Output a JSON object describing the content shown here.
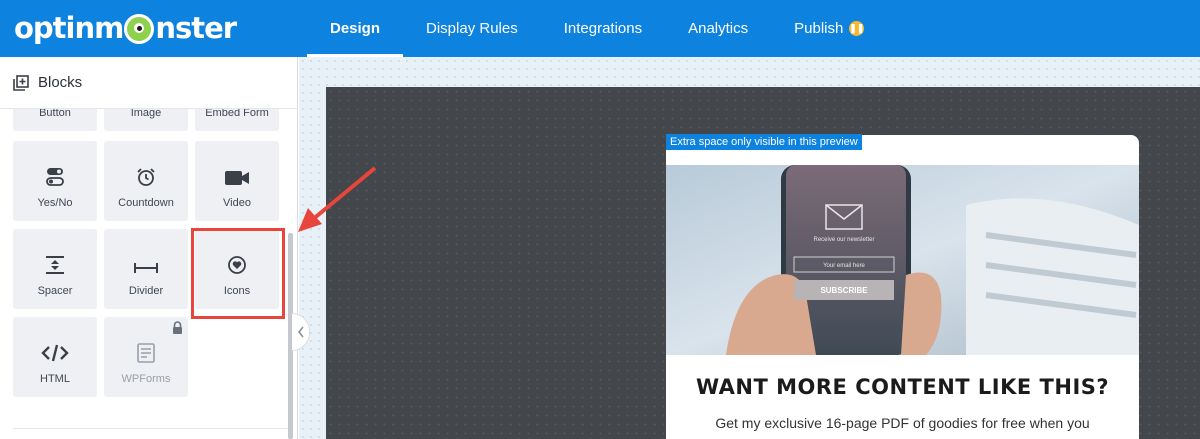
{
  "brand": {
    "logo_text_left": "optinm",
    "logo_text_right": "nster"
  },
  "nav": {
    "items": [
      {
        "label": "Design",
        "active": true
      },
      {
        "label": "Display Rules",
        "active": false
      },
      {
        "label": "Integrations",
        "active": false
      },
      {
        "label": "Analytics",
        "active": false
      },
      {
        "label": "Publish",
        "active": false
      }
    ],
    "publish_badge_icon": "pause-icon"
  },
  "sidebar": {
    "title": "Blocks",
    "title_icon": "blocks-icon",
    "blocks": [
      {
        "label": "Button",
        "icon": "button-icon"
      },
      {
        "label": "Image",
        "icon": "image-icon"
      },
      {
        "label": "Embed Form",
        "icon": "embed-form-icon"
      },
      {
        "label": "Yes/No",
        "icon": "toggle-icon"
      },
      {
        "label": "Countdown",
        "icon": "alarm-clock-icon"
      },
      {
        "label": "Video",
        "icon": "video-camera-icon"
      },
      {
        "label": "Spacer",
        "icon": "spacer-icon"
      },
      {
        "label": "Divider",
        "icon": "divider-icon"
      },
      {
        "label": "Icons",
        "icon": "heart-circle-icon",
        "highlighted": true
      },
      {
        "label": "HTML",
        "icon": "code-icon"
      },
      {
        "label": "WPForms",
        "icon": "form-icon",
        "locked": true
      }
    ]
  },
  "preview": {
    "tag": "Extra space only visible in this preview",
    "hero_phone_caption": "Receive our newsletter",
    "hero_phone_input": "Your email here",
    "hero_phone_button": "SUBSCRIBE",
    "headline": "WANT MORE CONTENT LIKE THIS?",
    "subtext": "Get my exclusive 16-page PDF of goodies for free when you"
  },
  "colors": {
    "brand_blue": "#0d82df",
    "annotation_red": "#e8453c",
    "canvas_dark": "#43464a"
  }
}
